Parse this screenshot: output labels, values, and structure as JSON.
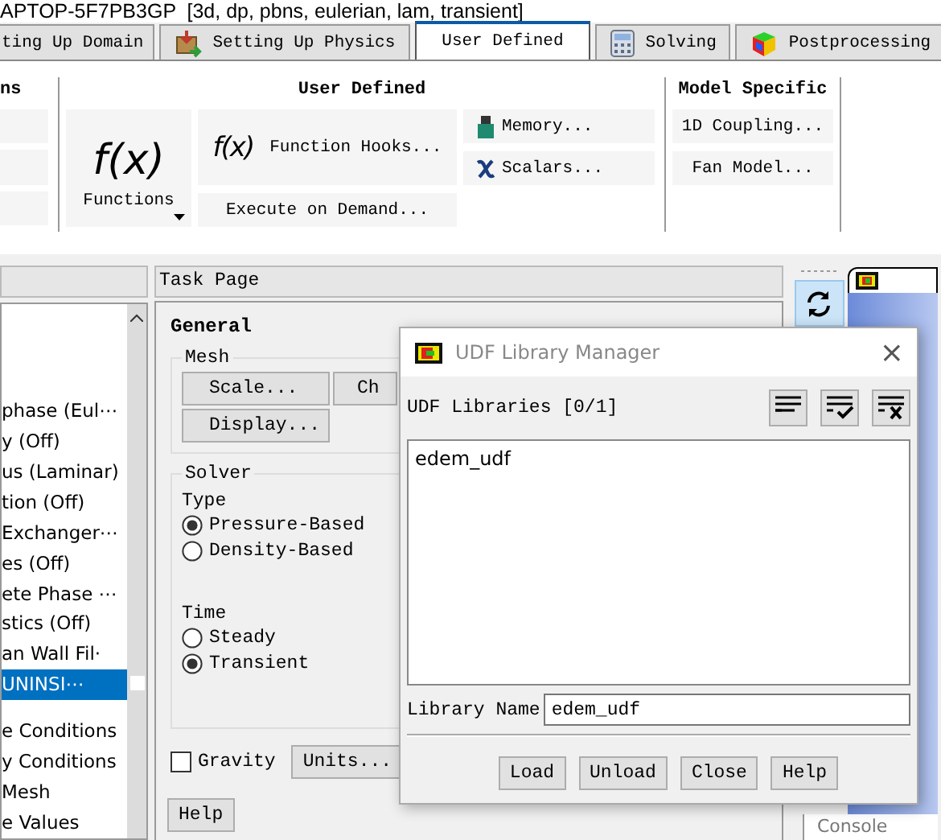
{
  "title_bar": {
    "text": "APTOP-5F7PB3GP  [3d, dp, pbns, eulerian, lam, transient]"
  },
  "tabs": [
    {
      "label": "ting Up Domain",
      "selected": false
    },
    {
      "label": "Setting Up Physics",
      "selected": false
    },
    {
      "label": "User Defined",
      "selected": true
    },
    {
      "label": "Solving",
      "selected": false
    },
    {
      "label": "Postprocessing",
      "selected": false
    }
  ],
  "ribbon": {
    "left_section": {
      "title": "ns"
    },
    "user_defined": {
      "title": "User Defined",
      "functions_glyph": "f(x)",
      "functions_label": "Functions",
      "hooks_glyph": "f(x)",
      "hooks_label": "Function Hooks...",
      "execute_label": "Execute on Demand...",
      "memory_label": "Memory...",
      "scalars_label": "Scalars..."
    },
    "model_specific": {
      "title": "Model Specific",
      "buttons": [
        "1D Coupling...",
        "Fan Model..."
      ]
    }
  },
  "tree": {
    "items": [
      {
        "label": "phase (Eul⋯",
        "selected": false
      },
      {
        "label": "y (Off)",
        "selected": false
      },
      {
        "label": "us (Laminar)",
        "selected": false
      },
      {
        "label": "tion (Off)",
        "selected": false
      },
      {
        "label": "Exchanger⋯",
        "selected": false
      },
      {
        "label": "es (Off)",
        "selected": false
      },
      {
        "label": "ete Phase ⋯",
        "selected": false
      },
      {
        "label": "stics (Off)",
        "selected": false
      },
      {
        "label": "an Wall Fil·",
        "selected": false
      },
      {
        "label": "UNINSI⋯",
        "selected": true
      },
      {
        "label": "e Conditions",
        "selected": false
      },
      {
        "label": "y Conditions",
        "selected": false
      },
      {
        "label": "Mesh",
        "selected": false
      },
      {
        "label": "e Values",
        "selected": false
      }
    ]
  },
  "task_page": {
    "title": "Task Page",
    "heading": "General",
    "mesh": {
      "title": "Mesh",
      "buttons": [
        "Scale...",
        "Ch",
        "Display..."
      ]
    },
    "solver": {
      "title": "Solver",
      "type_label": "Type",
      "type_options": [
        {
          "label": "Pressure-Based",
          "selected": true
        },
        {
          "label": "Density-Based",
          "selected": false
        }
      ],
      "time_label": "Time",
      "time_options": [
        {
          "label": "Steady",
          "selected": false
        },
        {
          "label": "Transient",
          "selected": true
        }
      ]
    },
    "gravity": {
      "label": "Gravity",
      "checked": false
    },
    "units_button": "Units...",
    "help_button": "Help"
  },
  "graphics": {
    "console_tab": "Console"
  },
  "dialog": {
    "title": "UDF Library Manager",
    "close": "×",
    "libraries_label": "UDF Libraries [0/1]",
    "libraries": [
      "edem_udf"
    ],
    "name_label": "Library Name",
    "name_value": "edem_udf",
    "buttons": [
      "Load",
      "Unload",
      "Close",
      "Help"
    ]
  }
}
